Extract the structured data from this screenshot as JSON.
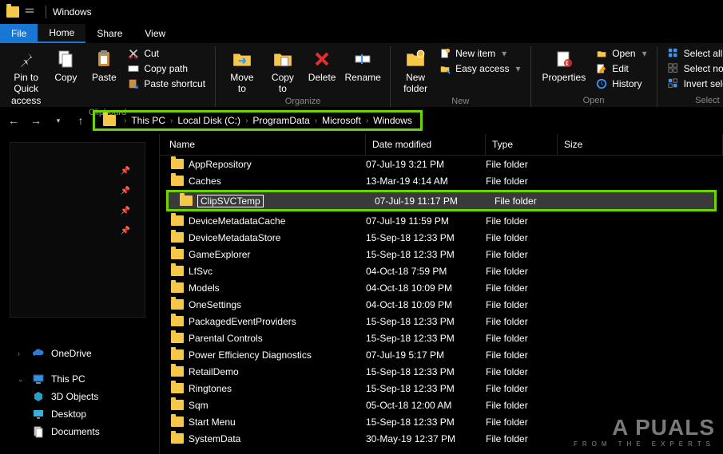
{
  "window": {
    "title": "Windows"
  },
  "tabs": {
    "file": "File",
    "home": "Home",
    "share": "Share",
    "view": "View"
  },
  "ribbon": {
    "clipboard": {
      "label": "Clipboard",
      "pin": "Pin to Quick access",
      "copy": "Copy",
      "paste": "Paste",
      "cut": "Cut",
      "copy_path": "Copy path",
      "paste_shortcut": "Paste shortcut"
    },
    "organize": {
      "label": "Organize",
      "move_to": "Move to",
      "copy_to": "Copy to",
      "delete": "Delete",
      "rename": "Rename"
    },
    "new": {
      "label": "New",
      "new_folder": "New folder",
      "new_item": "New item",
      "easy_access": "Easy access"
    },
    "open": {
      "label": "Open",
      "properties": "Properties",
      "open": "Open",
      "edit": "Edit",
      "history": "History"
    },
    "select": {
      "label": "Select",
      "select_all": "Select all",
      "select_none": "Select none",
      "invert": "Invert selection"
    }
  },
  "breadcrumb": {
    "parts": [
      "This PC",
      "Local Disk (C:)",
      "ProgramData",
      "Microsoft",
      "Windows"
    ]
  },
  "columns": {
    "name": "Name",
    "date": "Date modified",
    "type": "Type",
    "size": "Size"
  },
  "files": [
    {
      "name": "AppRepository",
      "date": "07-Jul-19 3:21 PM",
      "type": "File folder"
    },
    {
      "name": "Caches",
      "date": "13-Mar-19 4:14 AM",
      "type": "File folder"
    },
    {
      "name": "ClipSVCTemp",
      "date": "07-Jul-19 11:17 PM",
      "type": "File folder",
      "selected": true
    },
    {
      "name": "DeviceMetadataCache",
      "date": "07-Jul-19 11:59 PM",
      "type": "File folder"
    },
    {
      "name": "DeviceMetadataStore",
      "date": "15-Sep-18 12:33 PM",
      "type": "File folder"
    },
    {
      "name": "GameExplorer",
      "date": "15-Sep-18 12:33 PM",
      "type": "File folder"
    },
    {
      "name": "LfSvc",
      "date": "04-Oct-18 7:59 PM",
      "type": "File folder"
    },
    {
      "name": "Models",
      "date": "04-Oct-18 10:09 PM",
      "type": "File folder"
    },
    {
      "name": "OneSettings",
      "date": "04-Oct-18 10:09 PM",
      "type": "File folder"
    },
    {
      "name": "PackagedEventProviders",
      "date": "15-Sep-18 12:33 PM",
      "type": "File folder"
    },
    {
      "name": "Parental Controls",
      "date": "15-Sep-18 12:33 PM",
      "type": "File folder"
    },
    {
      "name": "Power Efficiency Diagnostics",
      "date": "07-Jul-19 5:17 PM",
      "type": "File folder"
    },
    {
      "name": "RetailDemo",
      "date": "15-Sep-18 12:33 PM",
      "type": "File folder"
    },
    {
      "name": "Ringtones",
      "date": "15-Sep-18 12:33 PM",
      "type": "File folder"
    },
    {
      "name": "Sqm",
      "date": "05-Oct-18 12:00 AM",
      "type": "File folder"
    },
    {
      "name": "Start Menu",
      "date": "15-Sep-18 12:33 PM",
      "type": "File folder"
    },
    {
      "name": "SystemData",
      "date": "30-May-19 12:37 PM",
      "type": "File folder"
    }
  ],
  "sidebar": {
    "onedrive": "OneDrive",
    "thispc": "This PC",
    "objects3d": "3D Objects",
    "desktop": "Desktop",
    "documents": "Documents"
  },
  "watermark": {
    "big": "A  PUALS",
    "small": "FROM THE EXPERTS"
  }
}
